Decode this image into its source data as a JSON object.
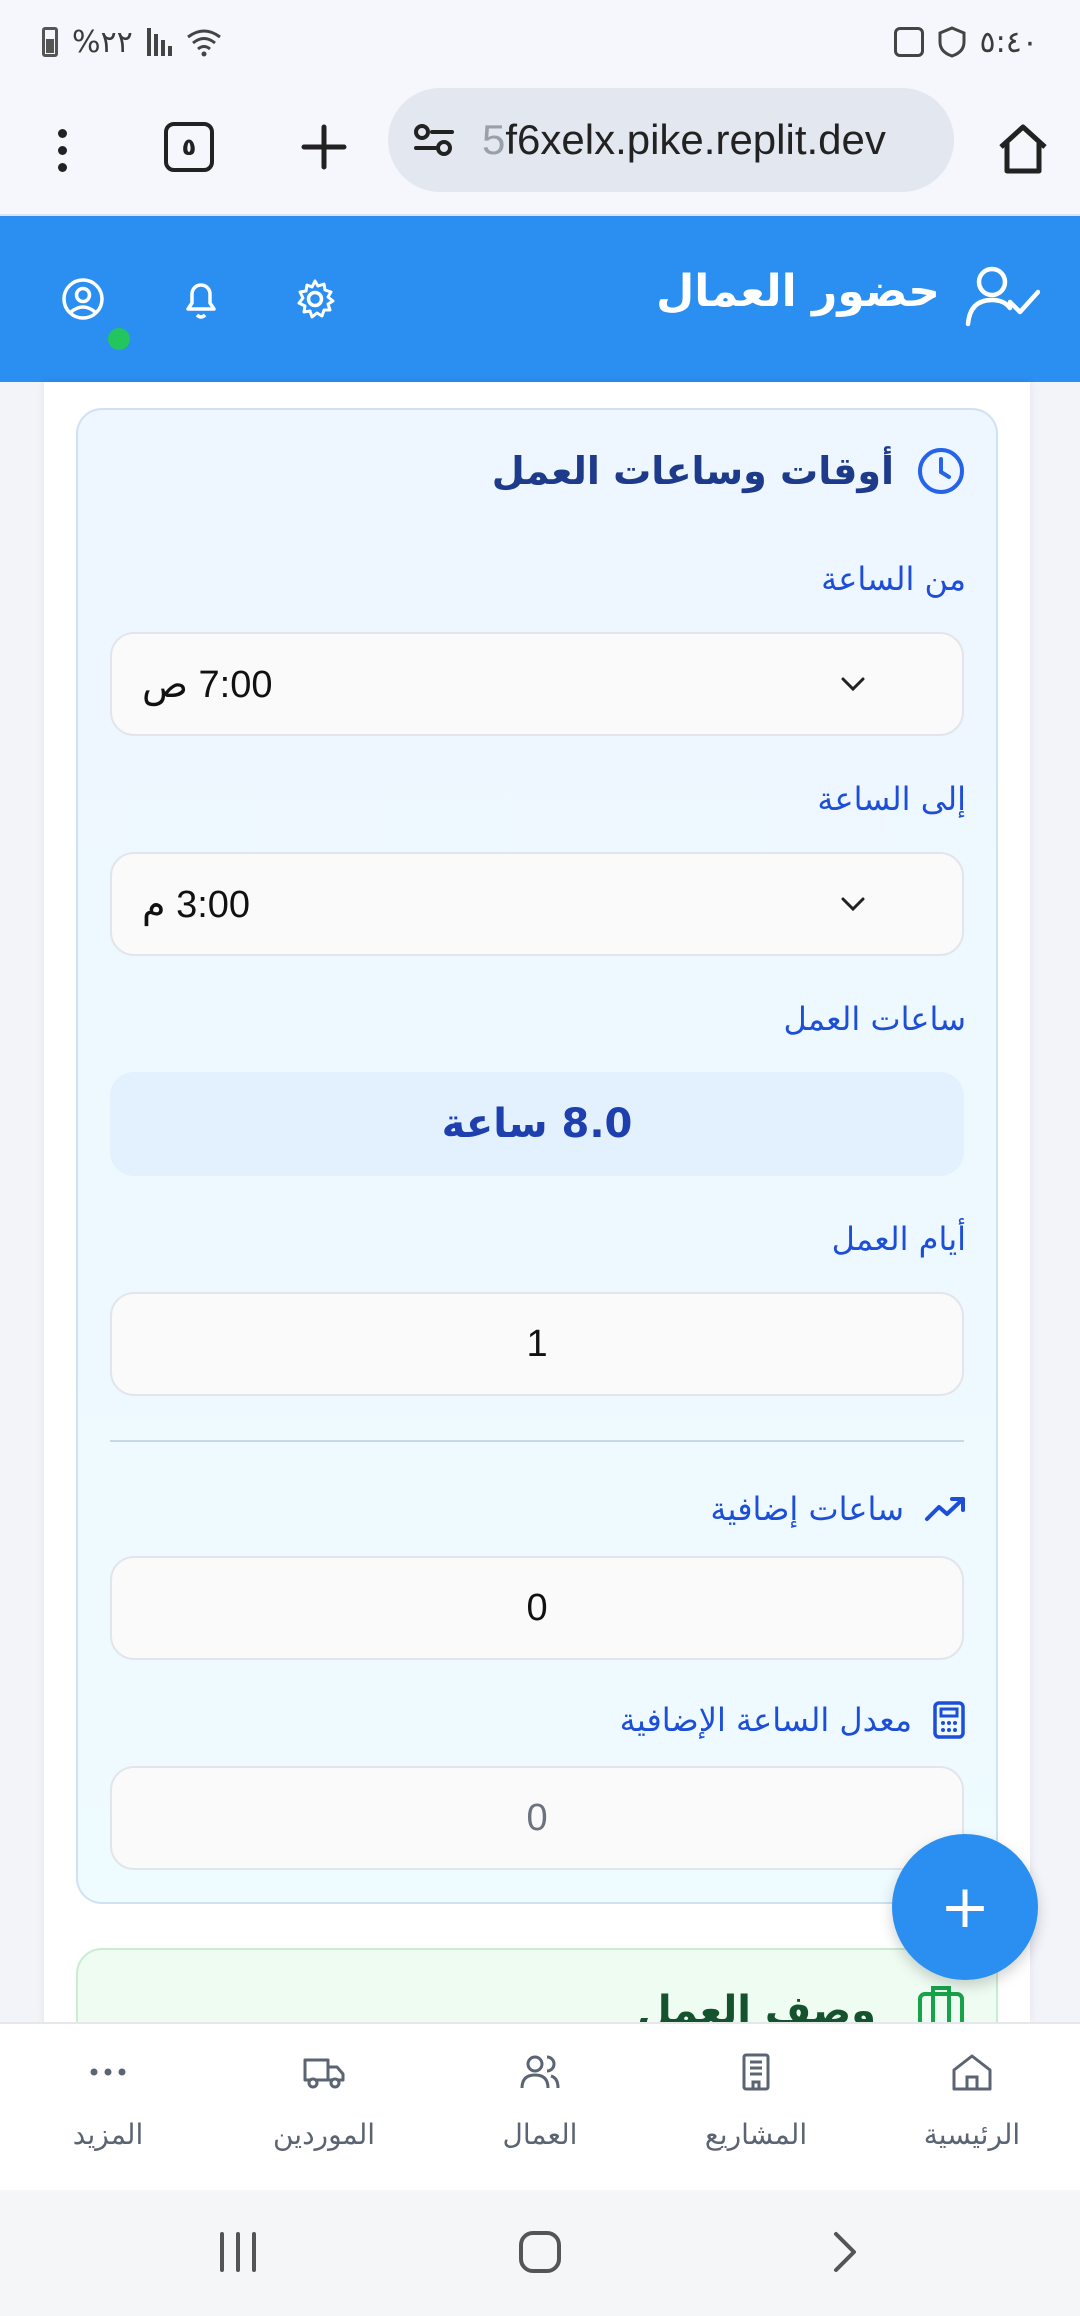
{
  "status_bar": {
    "time": "٥:٤٠",
    "battery": "%٢٢"
  },
  "browser": {
    "tab_count": "٥",
    "url_dim": "5",
    "url": "f6xelx.pike.replit.dev"
  },
  "header": {
    "title": "حضور العمال"
  },
  "time_card": {
    "title": "أوقات وساعات العمل",
    "from_label": "من الساعة",
    "from_value": "7:00 ص",
    "to_label": "إلى الساعة",
    "to_value": "3:00 م",
    "hours_label": "ساعات العمل",
    "hours_value": "8.0 ساعة",
    "days_label": "أيام العمل",
    "days_value": "1",
    "overtime_label": "ساعات إضافية",
    "overtime_value": "0",
    "overtime_rate_label": "معدل الساعة الإضافية",
    "overtime_rate_placeholder": "0"
  },
  "desc_card": {
    "title": "وصف العمل"
  },
  "fab": {
    "label": "+"
  },
  "bottom_nav": {
    "items": [
      {
        "label": "الرئيسية",
        "icon": "home-icon"
      },
      {
        "label": "المشاريع",
        "icon": "building-icon"
      },
      {
        "label": "العمال",
        "icon": "users-icon"
      },
      {
        "label": "الموردين",
        "icon": "truck-icon"
      },
      {
        "label": "المزيد",
        "icon": "more-icon"
      }
    ]
  },
  "colors": {
    "primary": "#2a8ff0",
    "online": "#22c55e",
    "card_title": "#1e3a8a",
    "label": "#1d4ed8"
  }
}
